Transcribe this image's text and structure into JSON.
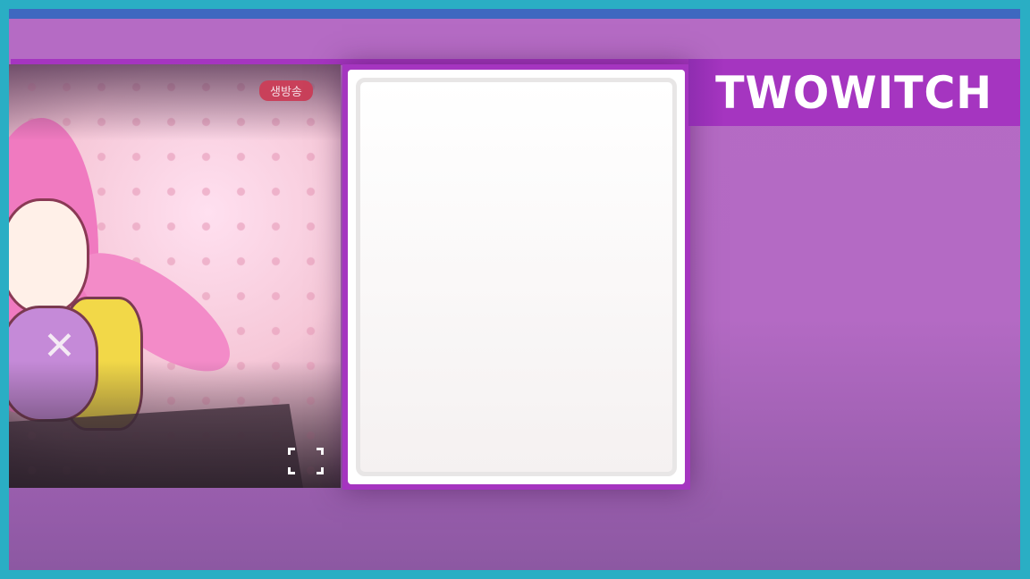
{
  "stream": {
    "live_badge": "생방송",
    "fullscreen_icon": "fullscreen-icon"
  },
  "banner": {
    "title": "TWOWITCH"
  },
  "colors": {
    "frame": "#2aaec4",
    "top_bar": "#3e68c0",
    "background": "#b56bc4",
    "accent": "#a535c0",
    "live_badge": "#c9405a"
  }
}
